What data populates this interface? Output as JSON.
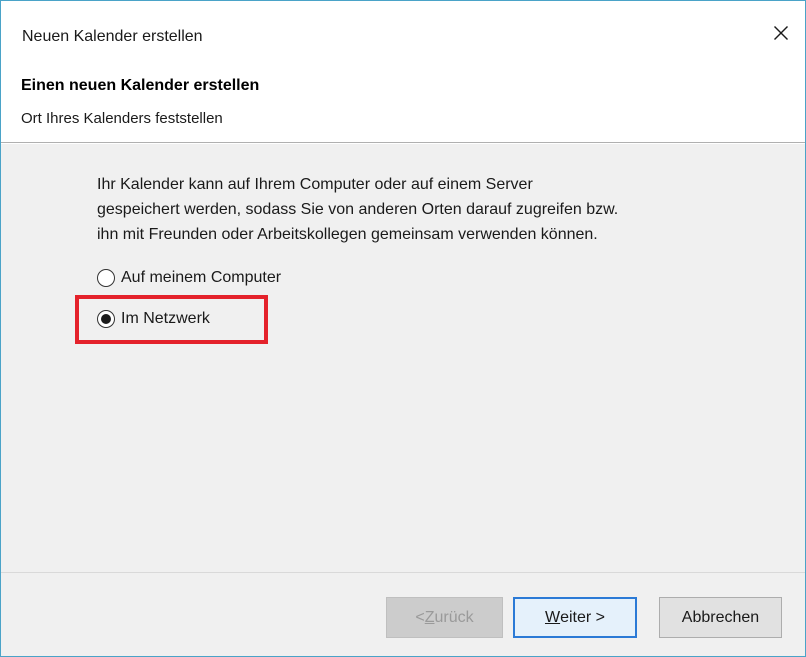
{
  "window": {
    "title": "Neuen Kalender erstellen",
    "close_label": "✕"
  },
  "header": {
    "title": "Einen neuen Kalender erstellen",
    "subtitle": "Ort Ihres Kalenders feststellen"
  },
  "content": {
    "description_lines": [
      "Ihr Kalender kann auf Ihrem Computer oder auf einem Server",
      "gespeichert werden, sodass Sie von anderen Orten darauf zugreifen bzw.",
      "ihn mit Freunden oder Arbeitskollegen gemeinsam verwenden können."
    ],
    "options": [
      {
        "label": "Auf meinem Computer",
        "selected": false
      },
      {
        "label": "Im Netzwerk",
        "selected": true
      }
    ],
    "highlight_color": "#e4222b"
  },
  "footer": {
    "back": {
      "prefix": "< ",
      "accel": "Z",
      "rest": "urück",
      "enabled": false
    },
    "next": {
      "accel": "W",
      "rest": "eiter >",
      "enabled": true
    },
    "cancel": {
      "label": "Abbrechen"
    }
  }
}
